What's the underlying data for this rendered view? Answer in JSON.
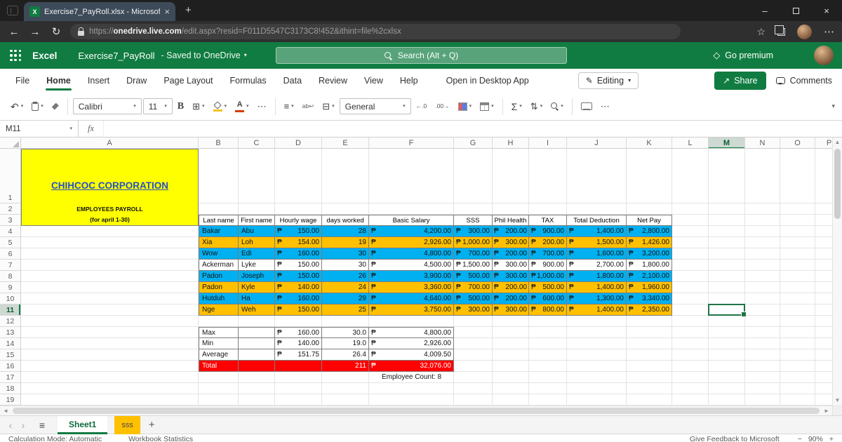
{
  "browser": {
    "tab_title": "Exercise7_PayRoll.xlsx - Microsof",
    "url_scheme": "https://",
    "url_host": "onedrive.live.com",
    "url_path": "/edit.aspx?resid=F011D5547C3173C8!452&ithint=file%2cxlsx"
  },
  "appbar": {
    "app_name": "Excel",
    "file_name": "Exercise7_PayRoll",
    "saved_status": "-  Saved to OneDrive",
    "search_placeholder": "Search (Alt + Q)",
    "go_premium_label": "Go premium"
  },
  "ribbon": {
    "tabs": [
      "File",
      "Home",
      "Insert",
      "Draw",
      "Page Layout",
      "Formulas",
      "Data",
      "Review",
      "View",
      "Help"
    ],
    "active_tab": "Home",
    "open_desktop_label": "Open in Desktop App",
    "editing_label": "Editing",
    "share_label": "Share",
    "comments_label": "Comments",
    "font_name": "Calibri",
    "font_size": "11",
    "number_format": "General"
  },
  "formula_bar": {
    "name_box": "M11",
    "fx_label": "fx",
    "formula": ""
  },
  "sheet": {
    "columns": [
      "A",
      "B",
      "C",
      "D",
      "E",
      "F",
      "G",
      "H",
      "I",
      "J",
      "K",
      "L",
      "M",
      "N",
      "O",
      "P"
    ],
    "row_count": 19,
    "selection": {
      "cell": "M11",
      "column": "M",
      "row": 11
    },
    "currency": "₱",
    "title_block": {
      "line1": "CHIHCOC CORPORATION",
      "line2": "EMPLOYEES PAYROLL",
      "line3": "(for april 1-30)"
    },
    "title_color": "#2350C8",
    "table": {
      "header_cols": [
        "B",
        "C",
        "D",
        "E",
        "F",
        "G",
        "H",
        "I",
        "J",
        "K"
      ],
      "headers": [
        "Last name",
        "First name",
        "Hourly wage",
        "days worked",
        "Basic Salary",
        "SSS",
        "Phil Health",
        "TAX",
        "Total Deduction",
        "Net Pay"
      ],
      "first_data_row": 4,
      "rows": [
        {
          "last": "Bakar",
          "first": "Abu",
          "wage": "150.00",
          "days": "28",
          "salary": "4,200.00",
          "sss": "300.00",
          "philhealth": "200.00",
          "tax": "900.00",
          "deduction": "1,400.00",
          "net": "2,800.00",
          "fill": "blue"
        },
        {
          "last": "Xia",
          "first": "Loh",
          "wage": "154.00",
          "days": "19",
          "salary": "2,926.00",
          "sss": "1,000.00",
          "philhealth": "300.00",
          "tax": "200.00",
          "deduction": "1,500.00",
          "net": "1,426.00",
          "fill": "orange"
        },
        {
          "last": "Wow",
          "first": "Edi",
          "wage": "160.00",
          "days": "30",
          "salary": "4,800.00",
          "sss": "700.00",
          "philhealth": "200.00",
          "tax": "700.00",
          "deduction": "1,600.00",
          "net": "3,200.00",
          "fill": "blue"
        },
        {
          "last": "Ackerman",
          "first": "Lyke",
          "wage": "150.00",
          "days": "30",
          "salary": "4,500.00",
          "sss": "1,500.00",
          "philhealth": "300.00",
          "tax": "900.00",
          "deduction": "2,700.00",
          "net": "1,800.00",
          "fill": "white"
        },
        {
          "last": "Padon",
          "first": "Joseph",
          "wage": "150.00",
          "days": "26",
          "salary": "3,900.00",
          "sss": "500.00",
          "philhealth": "300.00",
          "tax": "1,000.00",
          "deduction": "1,800.00",
          "net": "2,100.00",
          "fill": "blue"
        },
        {
          "last": "Padon",
          "first": "Kyle",
          "wage": "140.00",
          "days": "24",
          "salary": "3,360.00",
          "sss": "700.00",
          "philhealth": "200.00",
          "tax": "500.00",
          "deduction": "1,400.00",
          "net": "1,960.00",
          "fill": "orange"
        },
        {
          "last": "Hutduh",
          "first": "Ha",
          "wage": "160.00",
          "days": "29",
          "salary": "4,640.00",
          "sss": "500.00",
          "philhealth": "200.00",
          "tax": "600.00",
          "deduction": "1,300.00",
          "net": "3,340.00",
          "fill": "blue"
        },
        {
          "last": "Nge",
          "first": "Weh",
          "wage": "150.00",
          "days": "25",
          "salary": "3,750.00",
          "sss": "300.00",
          "philhealth": "300.00",
          "tax": "800.00",
          "deduction": "1,400.00",
          "net": "2,350.00",
          "fill": "orange"
        }
      ]
    },
    "summary": {
      "first_row": 13,
      "rows": [
        {
          "label": "Max",
          "wage": "160.00",
          "days": "30.0",
          "salary": "4,800.00"
        },
        {
          "label": "Min",
          "wage": "140.00",
          "days": "19.0",
          "salary": "2,926.00"
        },
        {
          "label": "Average",
          "wage": "151.75",
          "days": "26.4",
          "salary": "4,009.50"
        }
      ],
      "total": {
        "label": "Total",
        "days": "211",
        "salary": "32,076.00",
        "row": 16
      },
      "employee_count": "Employee Count: 8",
      "employee_count_row": 17
    },
    "fill_colors": {
      "blue": "#00B0F0",
      "orange": "#FFC000",
      "white": "#FFFFFF",
      "red": "#FF0000",
      "yellow": "#FFFF00"
    }
  },
  "sheet_tabs": {
    "sheets": [
      {
        "name": "Sheet1",
        "active": true
      },
      {
        "name": "sss",
        "active": false,
        "color": "#FFC000"
      }
    ]
  },
  "status_bar": {
    "calc_mode": "Calculation Mode: Automatic",
    "workbook_stats": "Workbook Statistics",
    "feedback": "Give Feedback to Microsoft",
    "zoom": "90%",
    "zoom_out": "−",
    "zoom_in": "+"
  },
  "colors": {
    "excel_green": "#107C41",
    "selection_green": "#217346"
  },
  "glyphs": {
    "back": "←",
    "forward": "→",
    "refresh": "↻",
    "plus": "+",
    "close": "×",
    "minimize": "–",
    "ellipsis": "⋯",
    "caret": "▾",
    "undo": "↶",
    "bold": "B",
    "sigma": "Σ",
    "sort": "⇅",
    "align": "≡",
    "borders": "⊞",
    "merge": "⊟",
    "wrap": "ab↩",
    "premium": "◇",
    "star": "☆",
    "menu": "≡",
    "chev_left": "‹",
    "chev_right": "›",
    "tri_up": "▲",
    "tri_down": "▼",
    "tri_left": "◄",
    "tri_right": "►",
    "pencil": "✎",
    "share": "↗",
    "excel_x": "X",
    "dec_decimal": "←.0",
    "inc_decimal": ".00→",
    "font_color_a": "A",
    "fill_a": ""
  }
}
